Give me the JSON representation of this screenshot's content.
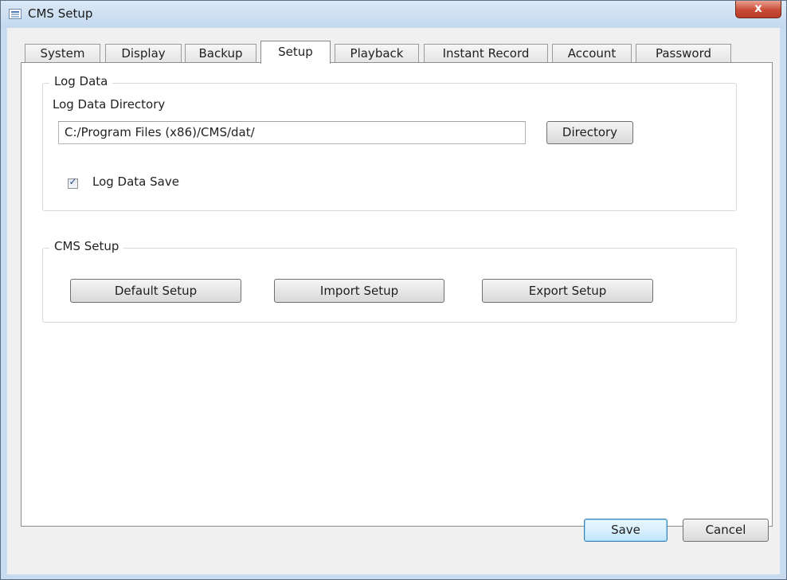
{
  "window": {
    "title": "CMS Setup",
    "close_label": "x",
    "icon": "settings-window-icon"
  },
  "tabs": [
    {
      "label": "System",
      "active": false
    },
    {
      "label": "Display",
      "active": false
    },
    {
      "label": "Backup",
      "active": false
    },
    {
      "label": "Setup",
      "active": true
    },
    {
      "label": "Playback",
      "active": false
    },
    {
      "label": "Instant Record",
      "active": false
    },
    {
      "label": "Account",
      "active": false
    },
    {
      "label": "Password",
      "active": false
    }
  ],
  "log_data": {
    "group_label": "Log Data",
    "directory_label": "Log Data Directory",
    "directory_value": "C:/Program Files (x86)/CMS/dat/",
    "directory_button": "Directory",
    "save_checkbox_label": "Log Data Save",
    "save_checked": true
  },
  "cms_setup": {
    "group_label": "CMS Setup",
    "default_button": "Default Setup",
    "import_button": "Import Setup",
    "export_button": "Export Setup"
  },
  "footer": {
    "save_label": "Save",
    "cancel_label": "Cancel"
  },
  "colors": {
    "accent_button_border": "#3c7fb1",
    "titlebar": "#c8dcef",
    "close_button": "#c94c37",
    "checkmark": "#2a4f80"
  }
}
